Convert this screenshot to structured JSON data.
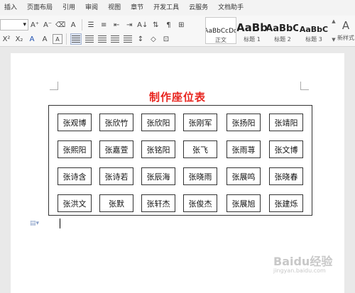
{
  "menu": {
    "tabs": [
      "插入",
      "页面布局",
      "引用",
      "审阅",
      "视图",
      "章节",
      "开发工具",
      "云服务",
      "文档助手"
    ]
  },
  "ribbon": {
    "font_size_value": "",
    "grow_font_label": "A",
    "shrink_font_label": "A",
    "superscript_label": "X²",
    "subscript_label": "X₂",
    "font_color_label": "A",
    "highlight_label": "A",
    "char_border_label": "A",
    "phonetic_label": "A",
    "sort_label": "A↓",
    "styles": [
      {
        "sample": "AaBbCcDd",
        "name": "正文"
      },
      {
        "sample": "AaBb",
        "name": "标题 1"
      },
      {
        "sample": "AaBbC",
        "name": "标题 2"
      },
      {
        "sample": "AaBbC",
        "name": "标题 3"
      }
    ],
    "new_style_label": "新样式"
  },
  "document": {
    "title": "制作座位表",
    "title_color": "#e8241e",
    "seats": [
      [
        "张观博",
        "张欣竹",
        "张欣阳",
        "张刚军",
        "张扬阳",
        "张靖阳"
      ],
      [
        "张熙阳",
        "张嘉萱",
        "张铭阳",
        "张飞",
        "张雨荨",
        "张文博"
      ],
      [
        "张诗含",
        "张诗若",
        "张辰海",
        "张晓雨",
        "张展鸣",
        "张晓春"
      ],
      [
        "张洪文",
        "张默",
        "张轩杰",
        "张俊杰",
        "张展旭",
        "张建烁"
      ]
    ]
  },
  "watermark": {
    "brand": "Baidu经验",
    "url": "jingyan.baidu.com"
  }
}
